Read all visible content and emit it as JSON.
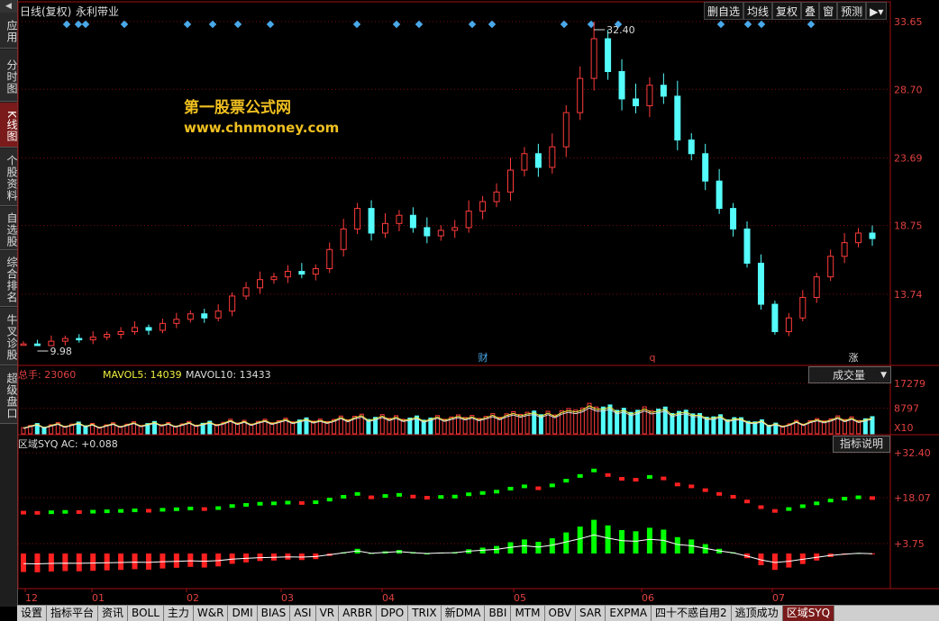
{
  "window": {
    "title": "日线(复权)",
    "stock_name": "永利带业"
  },
  "toolbar": {
    "items": [
      "删自选",
      "均线",
      "复权",
      "叠",
      "窗",
      "预测"
    ]
  },
  "sidebar": {
    "items": [
      {
        "label": "应用",
        "active": false
      },
      {
        "label": "分时图",
        "active": false
      },
      {
        "label": "K线图",
        "active": true
      },
      {
        "label": "个股资料",
        "active": false
      },
      {
        "label": "自选股",
        "active": false
      },
      {
        "label": "综合排名",
        "active": false
      },
      {
        "label": "牛叉诊股",
        "active": false
      },
      {
        "label": "超级盘口",
        "active": false
      }
    ]
  },
  "watermark": {
    "line1": "第一股票公式网",
    "line2": "www.chnmoney.com"
  },
  "price_panel": {
    "y_ticks": [
      "33.65",
      "28.70",
      "23.69",
      "18.75",
      "13.74"
    ],
    "high_label": "32.40",
    "low_label": "9.98",
    "markers": [
      "财",
      "q",
      "涨"
    ]
  },
  "volume_panel": {
    "total_label": "总手: 23060",
    "mavol5_label": "MAVOL5: 14039",
    "mavol10_label": "MAVOL10: 13433",
    "y_ticks": [
      "17279",
      "8797"
    ],
    "unit": "X10",
    "selector": "成交量"
  },
  "indicator_panel": {
    "label": "区域SYQ AC: +0.088",
    "y_ticks": [
      "+32.40",
      "+18.07",
      "+3.75"
    ],
    "explain_button": "指标说明"
  },
  "x_axis": {
    "ticks": [
      "12",
      "01",
      "02",
      "03",
      "04",
      "05",
      "06",
      "07"
    ]
  },
  "bottom_tabs": {
    "items": [
      {
        "label": "设置",
        "active": false
      },
      {
        "label": "指标平台",
        "active": false
      },
      {
        "label": "资讯",
        "active": false
      },
      {
        "label": "BOLL",
        "active": false
      },
      {
        "label": "主力",
        "active": false
      },
      {
        "label": "W&R",
        "active": false
      },
      {
        "label": "DMI",
        "active": false
      },
      {
        "label": "BIAS",
        "active": false
      },
      {
        "label": "ASI",
        "active": false
      },
      {
        "label": "VR",
        "active": false
      },
      {
        "label": "ARBR",
        "active": false
      },
      {
        "label": "DPO",
        "active": false
      },
      {
        "label": "TRIX",
        "active": false
      },
      {
        "label": "新DMA",
        "active": false
      },
      {
        "label": "BBI",
        "active": false
      },
      {
        "label": "MTM",
        "active": false
      },
      {
        "label": "OBV",
        "active": false
      },
      {
        "label": "SAR",
        "active": false
      },
      {
        "label": "EXPMA",
        "active": false
      },
      {
        "label": "四十不惑自用2",
        "active": false
      },
      {
        "label": "逃顶成功",
        "active": false
      },
      {
        "label": "区域SYQ",
        "active": true
      }
    ]
  },
  "colors": {
    "up": "#ff3b3b",
    "down": "#54fcfc",
    "frame": "#a01010",
    "grid": "#7a0c0c",
    "axis_text": "#e04040",
    "marker": "#4aa8e8",
    "ind_green": "#00ff00",
    "ind_red": "#ff2020",
    "line_white": "#ffffff"
  },
  "chart_data": {
    "type": "candlestick",
    "y_range": [
      9.98,
      33.65
    ],
    "x_months": [
      "12",
      "01",
      "02",
      "03",
      "04",
      "05",
      "06",
      "07"
    ],
    "close_series": [
      10.1,
      9.98,
      10.3,
      10.5,
      10.4,
      10.6,
      10.8,
      11.0,
      11.3,
      11.1,
      11.6,
      11.9,
      12.3,
      12.0,
      12.5,
      13.6,
      14.2,
      14.8,
      15.0,
      15.4,
      15.2,
      15.6,
      17.0,
      18.5,
      20.0,
      18.2,
      18.9,
      19.5,
      18.6,
      18.0,
      18.4,
      18.6,
      19.8,
      20.5,
      21.2,
      22.8,
      24.0,
      23.0,
      24.5,
      27.0,
      29.5,
      32.4,
      30.0,
      28.0,
      27.5,
      29.0,
      28.2,
      25.0,
      24.0,
      22.0,
      20.0,
      18.5,
      16.0,
      13.0,
      11.0,
      12.0,
      13.5,
      15.0,
      16.5,
      17.5,
      18.2,
      17.8
    ]
  }
}
